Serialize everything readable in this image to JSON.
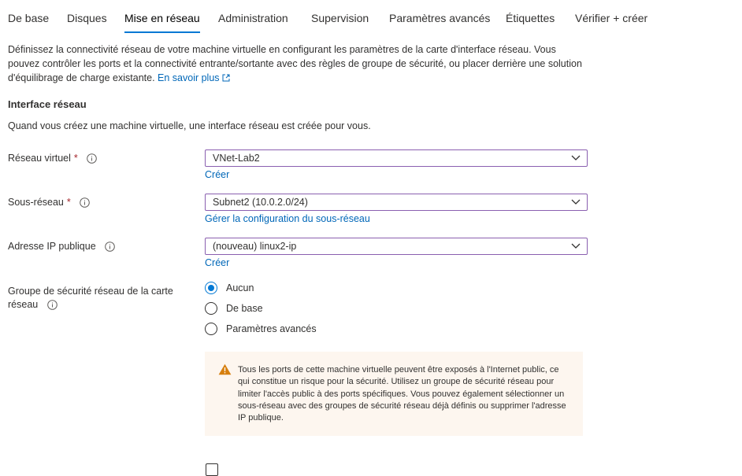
{
  "tabs": [
    {
      "label": "De base"
    },
    {
      "label": "Disques"
    },
    {
      "label": "Mise en réseau"
    },
    {
      "label": "Administration"
    },
    {
      "label": "Supervision"
    },
    {
      "label": "Paramètres avancés"
    },
    {
      "label": "Étiquettes"
    },
    {
      "label": "Vérifier + créer"
    }
  ],
  "active_tab": "Mise en réseau",
  "description": {
    "text": "Définissez la connectivité réseau de votre machine virtuelle en configurant les paramètres de la carte d'interface réseau. Vous pouvez contrôler les ports et la connectivité entrante/sortante avec des règles de groupe de sécurité, ou placer derrière une solution d'équilibrage de charge existante.",
    "learn_more": "En savoir plus"
  },
  "section": {
    "title": "Interface réseau",
    "subtitle": "Quand vous créez une machine virtuelle, une interface réseau est créée pour vous."
  },
  "fields": {
    "vnet": {
      "label": "Réseau virtuel",
      "required": "*",
      "value": "VNet-Lab2",
      "link": "Créer"
    },
    "subnet": {
      "label": "Sous-réseau",
      "required": "*",
      "value": "Subnet2 (10.0.2.0/24)",
      "link": "Gérer la configuration du sous-réseau"
    },
    "public_ip": {
      "label": "Adresse IP publique",
      "value": "(nouveau) linux2-ip",
      "link": "Créer"
    },
    "nsg": {
      "label_line1": "Groupe de sécurité réseau de la carte",
      "label_line2": "réseau",
      "options": [
        "Aucun",
        "De base",
        "Paramètres avancés"
      ],
      "selected": "Aucun"
    }
  },
  "warning": {
    "text": "Tous les ports de cette machine virtuelle peuvent être exposés à l'Internet public, ce qui constitue un risque pour la sécurité. Utilisez un groupe de sécurité réseau pour limiter l'accès public à des ports spécifiques. Vous pouvez également sélectionner un sous-réseau avec des groupes de sécurité réseau déjà définis ou supprimer l'adresse IP publique."
  },
  "colors": {
    "accent": "#0078d4",
    "link": "#0067b8",
    "required": "#a4262c",
    "select_border": "#8a5fb0",
    "warning_bg": "#fdf6ef",
    "warning_icon": "#d67f0e"
  },
  "icons": {
    "info": "info-icon",
    "chevron": "chevron-down-icon",
    "external": "external-link-icon",
    "warning": "warning-icon"
  }
}
